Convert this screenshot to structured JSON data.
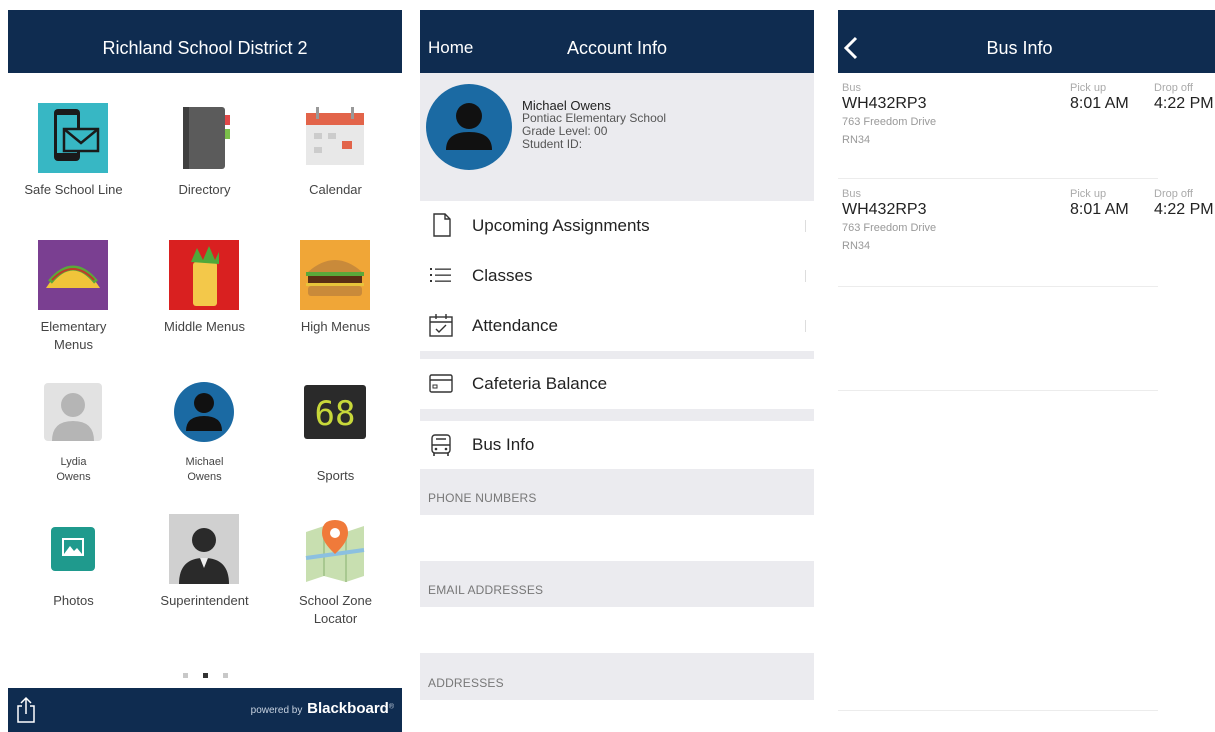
{
  "colors": {
    "navbar": "#0f2c50",
    "accent_blue": "#1b6aa3"
  },
  "home": {
    "title": "Richland School District 2",
    "tiles": [
      {
        "label": "Safe School Line",
        "icon": "phone-mail-icon"
      },
      {
        "label": "Directory",
        "icon": "notebook-icon"
      },
      {
        "label": "Calendar",
        "icon": "calendar-icon"
      },
      {
        "label": "Elementary\nMenus",
        "icon": "taco-icon"
      },
      {
        "label": "Middle Menus",
        "icon": "burrito-icon"
      },
      {
        "label": "High Menus",
        "icon": "burger-icon"
      },
      {
        "label": "Lydia\nOwens",
        "icon": "person-icon"
      },
      {
        "label": "Michael\nOwens",
        "icon": "avatar-icon"
      },
      {
        "label": "Sports",
        "icon": "scoreboard-icon"
      },
      {
        "label": "Photos",
        "icon": "photos-icon"
      },
      {
        "label": "Superintendent",
        "icon": "person-photo-icon"
      },
      {
        "label": "School Zone\nLocator",
        "icon": "map-pin-icon"
      }
    ],
    "scoreboard_digits": "68",
    "footer": {
      "powered_by": "powered by",
      "brand": "Blackboard",
      "trademark": "®"
    }
  },
  "account": {
    "nav_left": "Home",
    "title": "Account Info",
    "profile": {
      "name": "Michael Owens",
      "school": "Pontiac Elementary School",
      "grade": "Grade Level: 00",
      "student_id": "Student ID:"
    },
    "menu": [
      {
        "label": "Upcoming Assignments",
        "icon": "document-icon"
      },
      {
        "label": "Classes",
        "icon": "list-icon"
      },
      {
        "label": "Attendance",
        "icon": "calendar-check-icon"
      },
      {
        "label": "Cafeteria Balance",
        "icon": "card-icon"
      },
      {
        "label": "Bus Info",
        "icon": "bus-icon"
      }
    ],
    "sections": [
      "PHONE NUMBERS",
      "EMAIL ADDRESSES",
      "ADDRESSES"
    ]
  },
  "bus": {
    "title": "Bus Info",
    "rows": [
      {
        "bus_label": "Bus",
        "bus": "WH432RP3",
        "address": "763 Freedom Drive",
        "code": "RN34",
        "pickup_label": "Pick up",
        "pickup": "8:01 AM",
        "dropoff_label": "Drop off",
        "dropoff": "4:22 PM"
      },
      {
        "bus_label": "Bus",
        "bus": "WH432RP3",
        "address": "763 Freedom Drive",
        "code": "RN34",
        "pickup_label": "Pick up",
        "pickup": "8:01 AM",
        "dropoff_label": "Drop off",
        "dropoff": "4:22 PM"
      }
    ]
  }
}
